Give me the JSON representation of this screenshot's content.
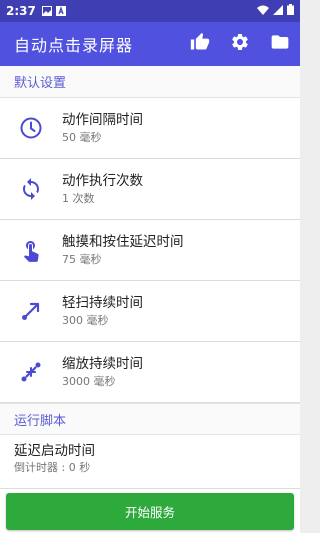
{
  "status_bar": {
    "time": "2:37",
    "left_icons": [
      "gallery-icon",
      "notification-a-icon"
    ],
    "right_icons": [
      "wifi-icon",
      "signal-icon",
      "battery-icon"
    ]
  },
  "app_bar": {
    "title": "自动点击录屏器",
    "actions": [
      "thumbs-up-icon",
      "gear-icon",
      "folder-icon"
    ]
  },
  "default_settings": {
    "header": "默认设置",
    "items": [
      {
        "icon": "clock-icon",
        "title": "动作间隔时间",
        "value": "50 毫秒"
      },
      {
        "icon": "repeat-icon",
        "title": "动作执行次数",
        "value": "1 次数"
      },
      {
        "icon": "touch-hold-icon",
        "title": "触摸和按住延迟时间",
        "value": "75 毫秒"
      },
      {
        "icon": "swipe-icon",
        "title": "轻扫持续时间",
        "value": "300 毫秒"
      },
      {
        "icon": "pinch-icon",
        "title": "缩放持续时间",
        "value": "3000 毫秒"
      }
    ]
  },
  "run_script": {
    "header": "运行脚本",
    "items": [
      {
        "title": "延迟启动时间",
        "value": "倒计时器 : 0 秒"
      }
    ]
  },
  "bottom": {
    "start_button": "开始服务"
  },
  "colors": {
    "status_bar": "#3f3fb3",
    "app_bar": "#5151e0",
    "accent": "#5b5bd6",
    "icon": "#4a4ad4",
    "start_button": "#2eaa3d"
  }
}
